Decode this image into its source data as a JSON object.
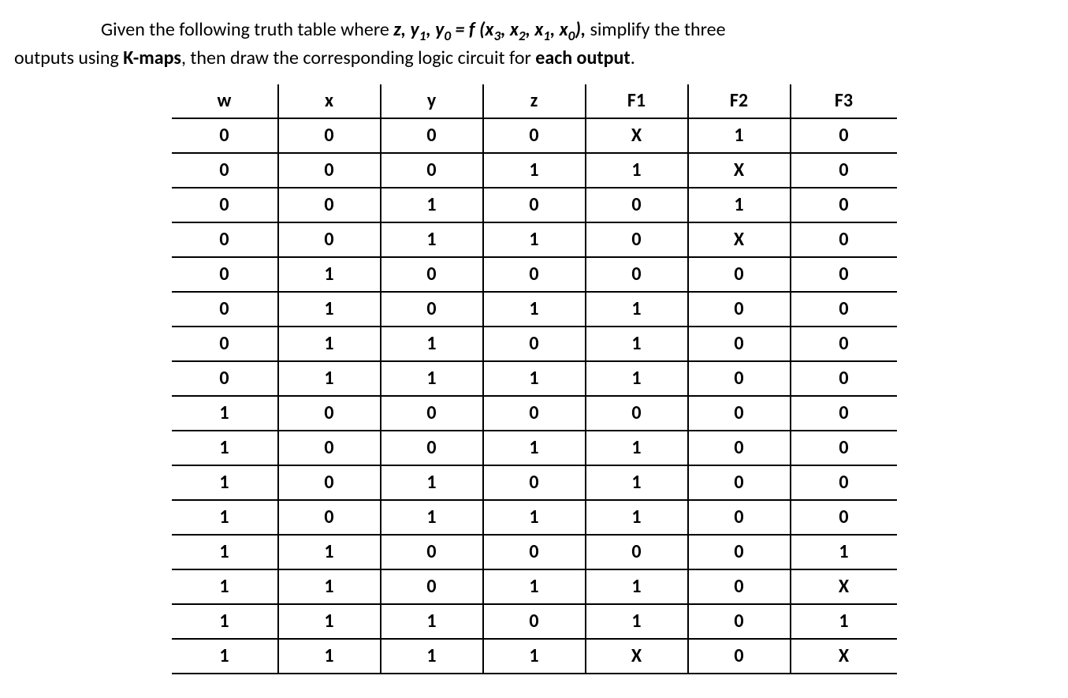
{
  "problem": {
    "line1_prefix": "Given the following truth table where ",
    "expr_lhs_z": "z, y",
    "sub1": "1",
    "expr_comma": ", y",
    "sub0": "0",
    "expr_eq": " = f (x",
    "sub3": "3",
    "expr_c1": ", x",
    "sub2": "2",
    "expr_c2": ", x",
    "sub1b": "1",
    "expr_c3": ", x",
    "sub0b": "0",
    "expr_close": "),",
    "line1_suffix": " simplify the three",
    "line2_prefix": "outputs using ",
    "kmaps": "K-maps",
    "line2_mid": ", then draw the corresponding logic circuit for ",
    "each_output": "each output",
    "line2_suffix": "."
  },
  "chart_data": {
    "type": "table",
    "headers": [
      "w",
      "x",
      "y",
      "z",
      "F1",
      "F2",
      "F3"
    ],
    "rows": [
      [
        "0",
        "0",
        "0",
        "0",
        "X",
        "1",
        "0"
      ],
      [
        "0",
        "0",
        "0",
        "1",
        "1",
        "X",
        "0"
      ],
      [
        "0",
        "0",
        "1",
        "0",
        "0",
        "1",
        "0"
      ],
      [
        "0",
        "0",
        "1",
        "1",
        "0",
        "X",
        "0"
      ],
      [
        "0",
        "1",
        "0",
        "0",
        "0",
        "0",
        "0"
      ],
      [
        "0",
        "1",
        "0",
        "1",
        "1",
        "0",
        "0"
      ],
      [
        "0",
        "1",
        "1",
        "0",
        "1",
        "0",
        "0"
      ],
      [
        "0",
        "1",
        "1",
        "1",
        "1",
        "0",
        "0"
      ],
      [
        "1",
        "0",
        "0",
        "0",
        "0",
        "0",
        "0"
      ],
      [
        "1",
        "0",
        "0",
        "1",
        "1",
        "0",
        "0"
      ],
      [
        "1",
        "0",
        "1",
        "0",
        "1",
        "0",
        "0"
      ],
      [
        "1",
        "0",
        "1",
        "1",
        "1",
        "0",
        "0"
      ],
      [
        "1",
        "1",
        "0",
        "0",
        "0",
        "0",
        "1"
      ],
      [
        "1",
        "1",
        "0",
        "1",
        "1",
        "0",
        "X"
      ],
      [
        "1",
        "1",
        "1",
        "0",
        "1",
        "0",
        "1"
      ],
      [
        "1",
        "1",
        "1",
        "1",
        "X",
        "0",
        "X"
      ]
    ]
  }
}
